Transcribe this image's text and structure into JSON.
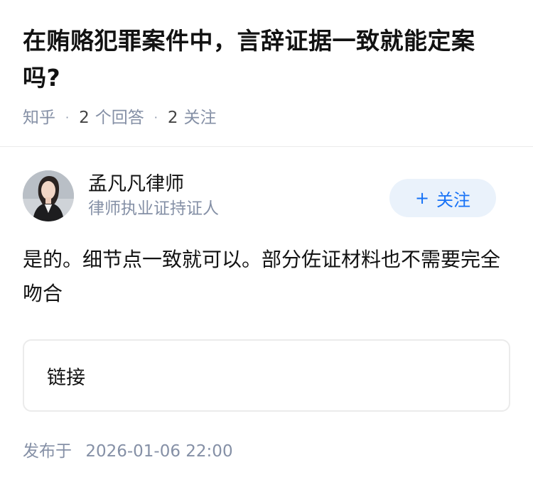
{
  "question": {
    "title": "在贿赂犯罪案件中，言辞证据一致就能定案吗?",
    "source": "知乎",
    "answer_count": "2",
    "answer_label": "个回答",
    "follow_count": "2",
    "follow_label": "关注"
  },
  "author": {
    "name": "孟凡凡律师",
    "badge": "律师执业证持证人",
    "follow_button": "关注",
    "follow_icon": "plus-icon"
  },
  "answer": {
    "text": "是的。细节点一致就可以。部分佐证材料也不需要完全吻合"
  },
  "link_card": {
    "label": "链接"
  },
  "publish": {
    "label": "发布于",
    "time": "2026-01-06 22:00"
  },
  "colors": {
    "accent": "#1772f6",
    "button_bg": "#eaf2fb",
    "meta": "#8590a6"
  }
}
